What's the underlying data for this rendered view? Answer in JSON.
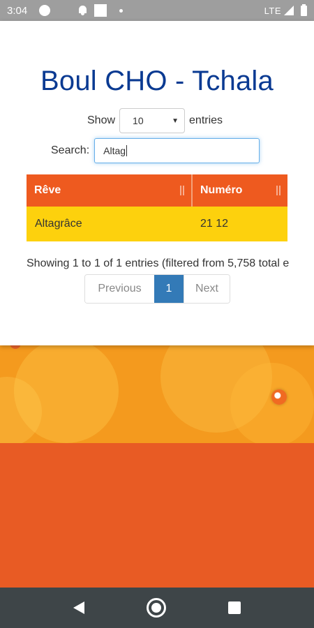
{
  "status_bar": {
    "time": "3:04",
    "network": "LTE"
  },
  "page": {
    "title": "Boul CHO - Tchala"
  },
  "length_control": {
    "prefix": "Show",
    "value": "10",
    "suffix": "entries"
  },
  "search": {
    "label": "Search:",
    "value": "Altag"
  },
  "table": {
    "columns": [
      "Rêve",
      "Numéro"
    ],
    "rows": [
      {
        "reve": "Altagrâce",
        "numero": "21 12"
      }
    ]
  },
  "info": "Showing 1 to 1 of 1 entries (filtered from 5,758 total e",
  "pagination": {
    "previous": "Previous",
    "current": "1",
    "next": "Next"
  },
  "colors": {
    "title": "#0a3a92",
    "header": "#ee5a1f",
    "row": "#fdd10d",
    "pager_active": "#337ab7",
    "background": "#e85b24"
  },
  "icons": [
    "circle-icon",
    "bell-icon",
    "square-icon",
    "signal-icon",
    "battery-icon",
    "back-icon",
    "home-icon",
    "recents-icon"
  ]
}
